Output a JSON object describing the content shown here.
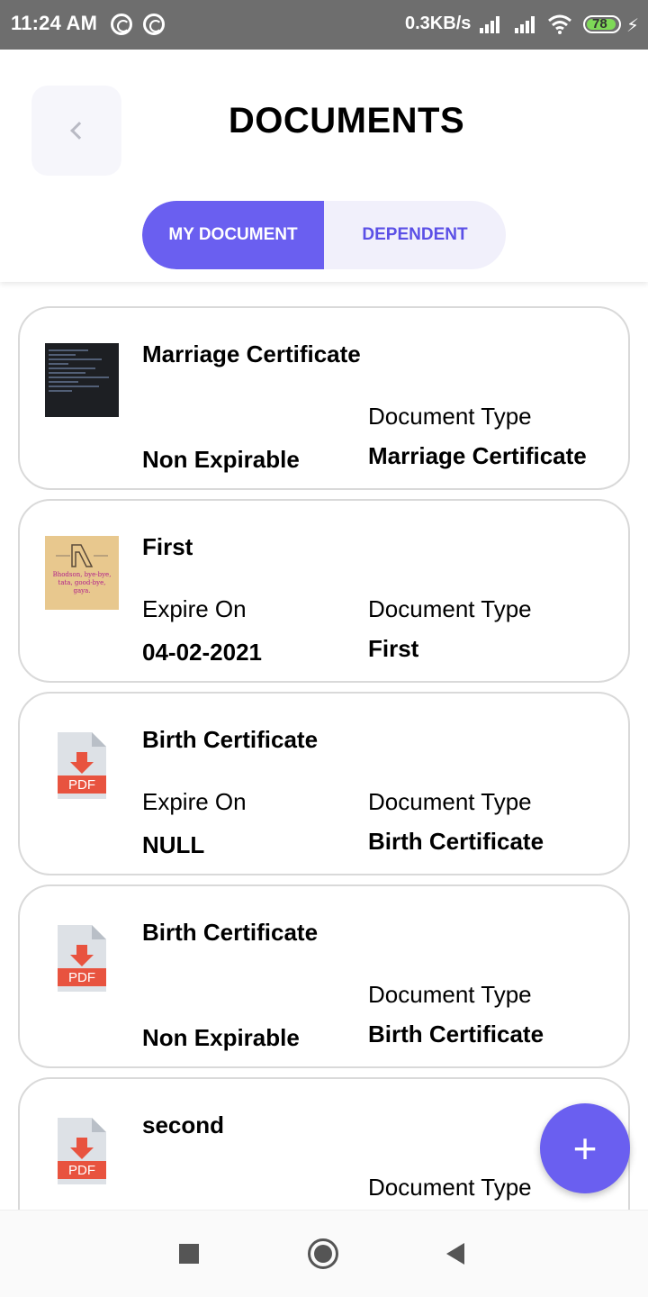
{
  "status_bar": {
    "time": "11:24 AM",
    "net_speed": "0.3KB/s",
    "battery": "78"
  },
  "header": {
    "title": "DOCUMENTS",
    "back_icon": "chevron-left-icon",
    "tabs": [
      {
        "label": "MY DOCUMENT",
        "active": true
      },
      {
        "label": "DEPENDENT",
        "active": false
      }
    ]
  },
  "documents": [
    {
      "name": "Marriage Certificate",
      "thumbnail": "code-image",
      "expire_label": "",
      "expire_value": "Non Expirable",
      "type_label": "Document Type",
      "type_value": "Marriage Certificate"
    },
    {
      "name": "First",
      "thumbnail": "art-image",
      "thumbnail_text": "Bhodson, bye-bye, tata, good-bye, gaya.",
      "expire_label": "Expire On",
      "expire_value": "04-02-2021",
      "type_label": "Document Type",
      "type_value": "First"
    },
    {
      "name": "Birth Certificate",
      "thumbnail": "pdf-icon",
      "expire_label": "Expire On",
      "expire_value": "NULL",
      "type_label": "Document Type",
      "type_value": "Birth Certificate"
    },
    {
      "name": "Birth Certificate",
      "thumbnail": "pdf-icon",
      "expire_label": "",
      "expire_value": "Non Expirable",
      "type_label": "Document Type",
      "type_value": "Birth Certificate"
    },
    {
      "name": "second",
      "thumbnail": "pdf-icon",
      "expire_label": "",
      "expire_value": "",
      "type_label": "Document Type",
      "type_value": ""
    }
  ],
  "pdf_label": "PDF",
  "fab": {
    "label": "+",
    "icon": "plus-icon"
  },
  "colors": {
    "accent": "#6a5ff0",
    "pdf_red": "#e8533f",
    "status_bar": "#6e6e6e"
  }
}
